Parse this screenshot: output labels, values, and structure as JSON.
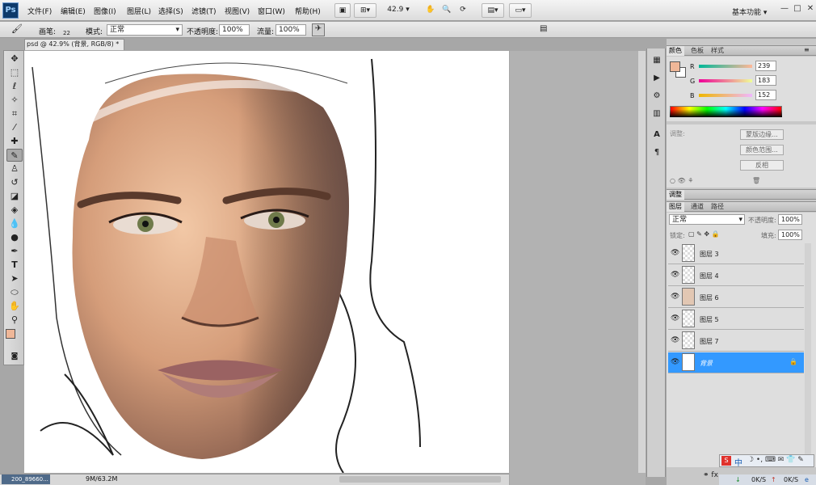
{
  "app": {
    "logo": "Ps"
  },
  "menu": [
    "文件(F)",
    "编辑(E)",
    "图像(I)",
    "图层(L)",
    "选择(S)",
    "滤镜(T)",
    "视图(V)",
    "窗口(W)",
    "帮助(H)"
  ],
  "toolbar": {
    "zoom": "42.9",
    "workspace": "基本功能",
    "window_controls": [
      "—",
      "□",
      "✕"
    ]
  },
  "options": {
    "brush_label": "画笔:",
    "brush_size": "22",
    "mode_label": "模式:",
    "mode_value": "正常",
    "opacity_label": "不透明度:",
    "opacity_value": "100%",
    "flow_label": "流量:",
    "flow_value": "100%"
  },
  "document": {
    "tab_title": "psd @ 42.9% (背景, RGB/8) *",
    "tab_close": "×",
    "doc_size": "9M/63.2M",
    "taskbar_item": "200_89660..."
  },
  "tools": [
    "move-icon",
    "marquee-icon",
    "lasso-icon",
    "magic-wand-icon",
    "crop-icon",
    "eyedropper-icon",
    "healing-icon",
    "brush-icon",
    "stamp-icon",
    "history-brush-icon",
    "eraser-icon",
    "gradient-icon",
    "blur-icon",
    "dodge-icon",
    "pen-icon",
    "type-icon",
    "path-select-icon",
    "shape-icon",
    "hand-icon",
    "zoom-icon"
  ],
  "colors": {
    "foreground": "#efb798",
    "background": "#ffffff",
    "selection": "#3399ff"
  },
  "color_panel": {
    "tabs": [
      "颜色",
      "色板",
      "样式"
    ],
    "r_label": "R",
    "g_label": "G",
    "b_label": "B",
    "r": "239",
    "g": "183",
    "b": "152"
  },
  "masks_panel": {
    "label": "调整:",
    "buttons": [
      "蒙版边缘...",
      "颜色范围...",
      "反相"
    ]
  },
  "adjust_tab": "调整",
  "layers_panel": {
    "tabs": [
      "图层",
      "通道",
      "路径"
    ],
    "blend_mode": "正常",
    "opacity_label": "不透明度:",
    "opacity_value": "100%",
    "lock_label": "锁定:",
    "fill_label": "填充:",
    "fill_value": "100%",
    "layers": [
      {
        "name": "图层 3",
        "selected": false
      },
      {
        "name": "图层 4",
        "selected": false
      },
      {
        "name": "图层 6",
        "selected": false
      },
      {
        "name": "图层 5",
        "selected": false
      },
      {
        "name": "图层 7",
        "selected": false
      },
      {
        "name": "背景",
        "selected": true
      }
    ],
    "footer_fx": "fx"
  },
  "system_tray": {
    "ime": "中",
    "net_down": "0K/S",
    "net_up": "0K/S"
  }
}
